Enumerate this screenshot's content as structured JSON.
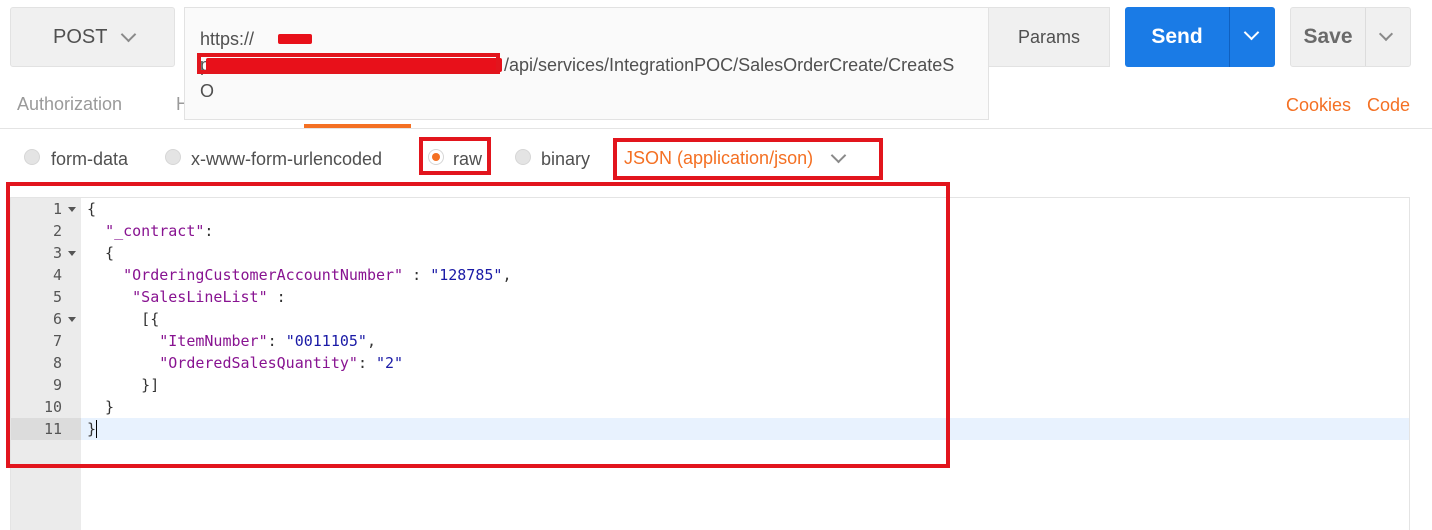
{
  "request": {
    "method": "POST",
    "url_line1": "https://",
    "url_line1_suffix": "-",
    "url_line2_start": "p",
    "url_line2_visible": "/api/services/IntegrationPOC/SalesOrderCreate/CreateS",
    "url_line3": "O",
    "params_label": "Params",
    "send_label": "Send",
    "save_label": "Save"
  },
  "tabs": {
    "authorization": "Authorization",
    "hidden_partial": "H",
    "cookies": "Cookies",
    "code": "Code"
  },
  "body_types": {
    "form_data": "form-data",
    "urlencoded": "x-www-form-urlencoded",
    "raw": "raw",
    "binary": "binary",
    "selected": "raw",
    "content_type": "JSON (application/json)"
  },
  "editor": {
    "line_numbers": [
      "1",
      "2",
      "3",
      "4",
      "5",
      "6",
      "7",
      "8",
      "9",
      "10",
      "11"
    ],
    "active_line": "11",
    "lines": [
      "{",
      "  \"_contract\":",
      "  {",
      "    \"OrderingCustomerAccountNumber\" : \"128785\",",
      "     \"SalesLineList\" :",
      "      [{",
      "        \"ItemNumber\": \"0011105\",",
      "        \"OrderedSalesQuantity\": \"2\"",
      "      }]",
      "  }",
      "}"
    ]
  },
  "colors": {
    "accent_orange": "#f47023",
    "send_blue": "#1a7be6",
    "annotation_red": "#e2151d",
    "json_key": "#881391",
    "json_string": "#1a1aa6"
  }
}
